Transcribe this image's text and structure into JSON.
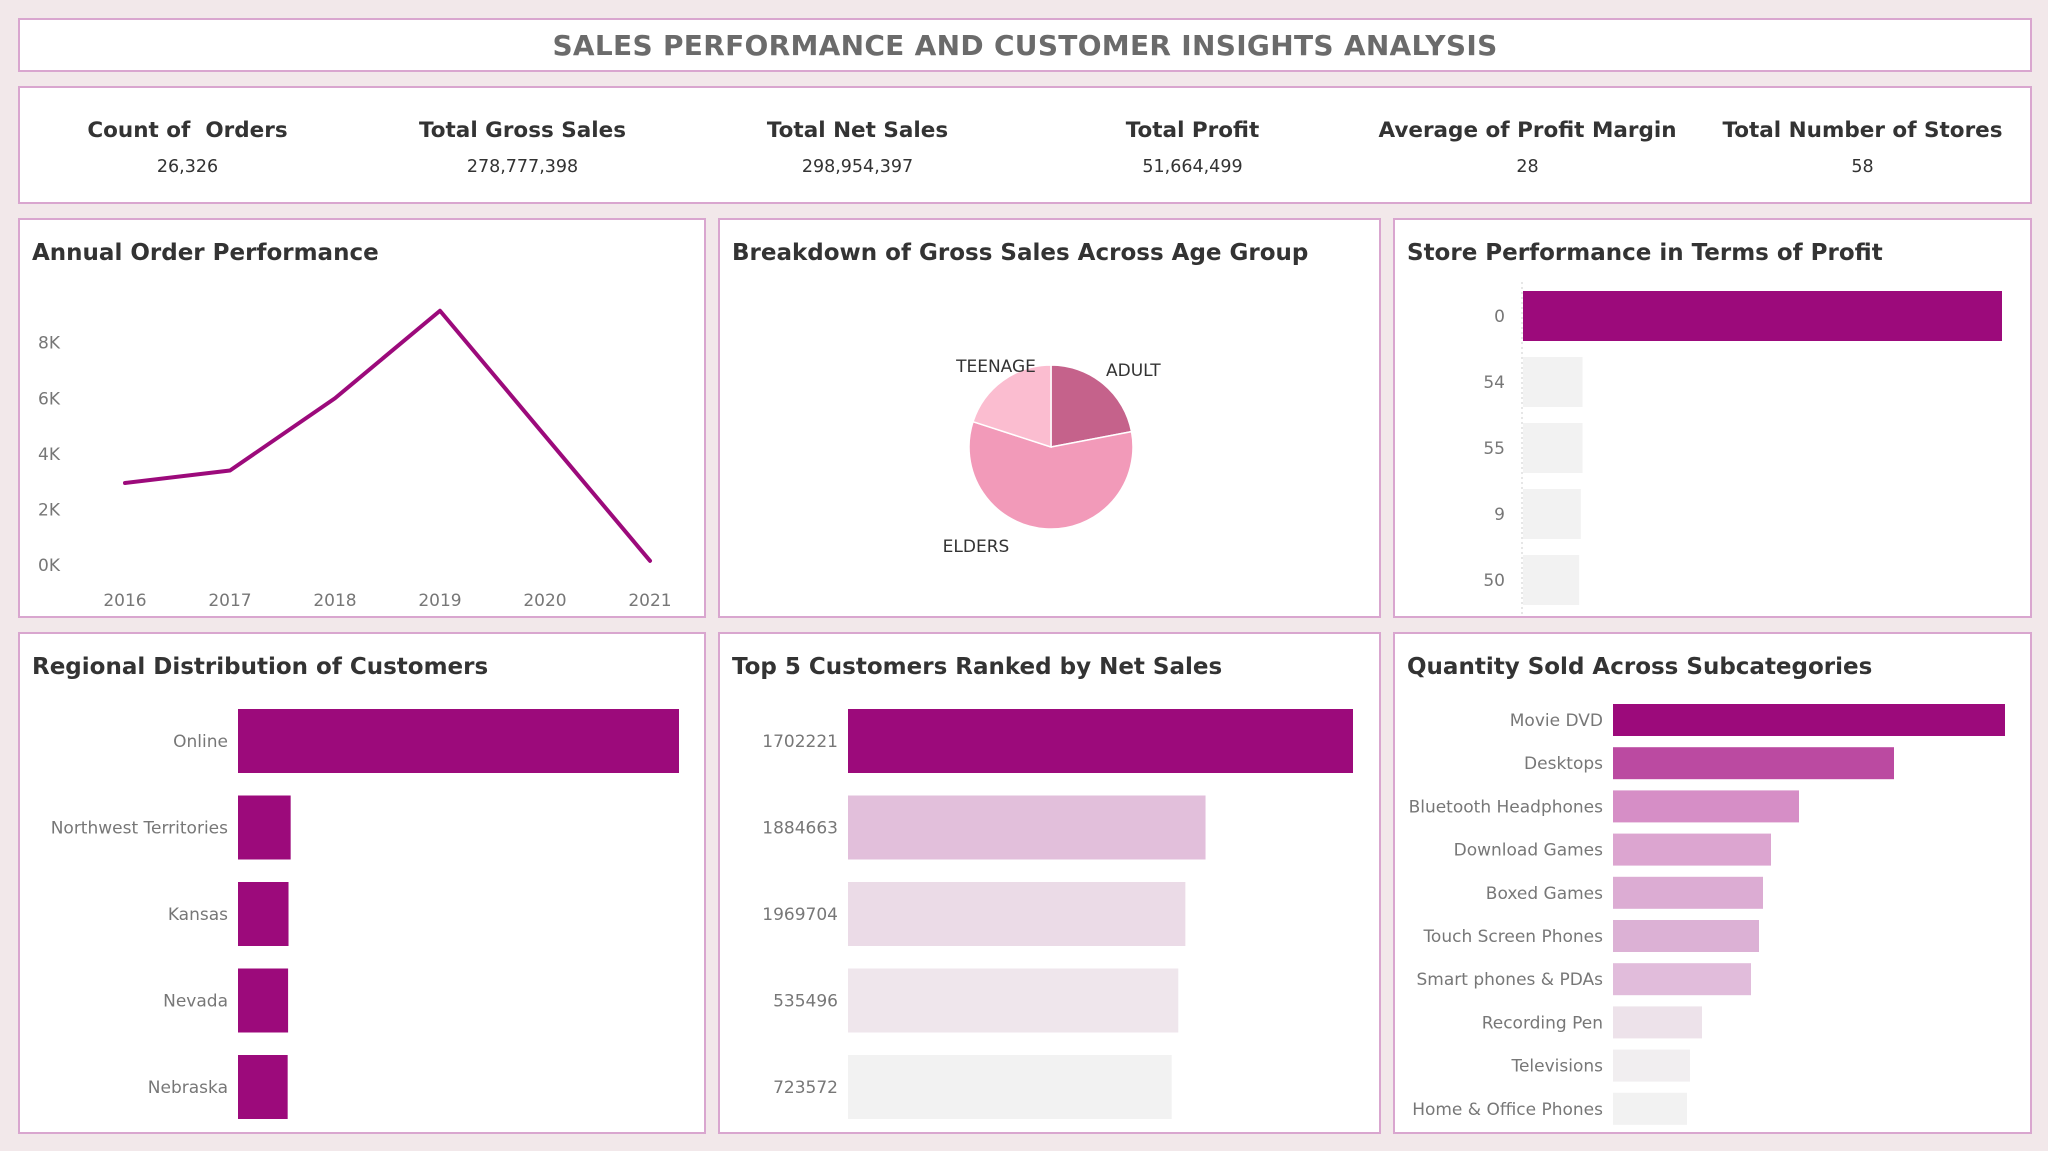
{
  "header": {
    "title": "SALES PERFORMANCE AND CUSTOMER INSIGHTS ANALYSIS"
  },
  "kpis": [
    {
      "label": "Count of  Orders",
      "value": "26,326"
    },
    {
      "label": "Total Gross Sales",
      "value": "278,777,398"
    },
    {
      "label": "Total Net Sales",
      "value": "298,954,397"
    },
    {
      "label": "Total Profit",
      "value": "51,664,499"
    },
    {
      "label": "Average of Profit Margin",
      "value": "28"
    },
    {
      "label": "Total Number of Stores",
      "value": "58"
    }
  ],
  "colors": {
    "magenta": "#9c0a7b",
    "light_bar": "#f2f2f2",
    "adult": "#c5628b",
    "elders": "#f29ab9",
    "teenage": "#fbbdd0"
  },
  "chart_data": [
    {
      "id": "annual",
      "type": "line",
      "title": "Annual Order Performance",
      "x": [
        "2016",
        "2017",
        "2018",
        "2019",
        "2020",
        "2021"
      ],
      "values": [
        2950,
        3400,
        6000,
        9150,
        4650,
        150
      ],
      "ylim": [
        0,
        9500
      ],
      "yticks": [
        0,
        2000,
        4000,
        6000,
        8000
      ],
      "ytick_labels": [
        "0K",
        "2K",
        "4K",
        "6K",
        "8K"
      ],
      "grid": false
    },
    {
      "id": "age",
      "type": "pie",
      "title": "Breakdown of Gross Sales Across Age Group",
      "slices": [
        {
          "label": "ADULT",
          "value": 22,
          "color": "#c5628b"
        },
        {
          "label": "ELDERS",
          "value": 58,
          "color": "#f29ab9"
        },
        {
          "label": "TEENAGE",
          "value": 20,
          "color": "#fbbdd0"
        }
      ]
    },
    {
      "id": "stores",
      "type": "bar",
      "orientation": "horizontal",
      "title": "Store Performance in Terms of Profit",
      "categories": [
        "0",
        "54",
        "55",
        "9",
        "50"
      ],
      "values": [
        2900000,
        360000,
        360000,
        350000,
        340000
      ],
      "colors": [
        "#9c0a7b",
        "#f2f2f2",
        "#f2f2f2",
        "#f2f2f2",
        "#f2f2f2"
      ],
      "xlim": [
        0,
        2900000
      ]
    },
    {
      "id": "regions",
      "type": "bar",
      "orientation": "horizontal",
      "title": "Regional Distribution of Customers",
      "categories": [
        "Online",
        "Northwest Territories",
        "Kansas",
        "Nevada",
        "Nebraska"
      ],
      "values": [
        10300,
        1230,
        1180,
        1170,
        1160
      ],
      "colors": [
        "#9c0a7b",
        "#9c0a7b",
        "#9c0a7b",
        "#9c0a7b",
        "#9c0a7b"
      ],
      "xlim": [
        0,
        10300
      ]
    },
    {
      "id": "customers",
      "type": "bar",
      "orientation": "horizontal",
      "title": "Top 5 Customers Ranked by Net Sales",
      "categories": [
        "1702221",
        "1884663",
        "1969704",
        "535496",
        "723572"
      ],
      "values": [
        1000,
        708,
        668,
        654,
        641
      ],
      "colors": [
        "#9c0a7b",
        "#e2bfdb",
        "#ebdbe7",
        "#efe6ec",
        "#f2f2f2"
      ],
      "xlim": [
        0,
        1000
      ]
    },
    {
      "id": "subcats",
      "type": "bar",
      "orientation": "horizontal",
      "title": "Quantity Sold Across Subcategories",
      "categories": [
        "Movie DVD",
        "Desktops",
        "Bluetooth Headphones",
        "Download Games",
        "Boxed Games",
        "Touch Screen Phones",
        "Smart phones & PDAs",
        "Recording Pen",
        "Televisions",
        "Home & Office Phones"
      ],
      "values": [
        3920,
        2810,
        1860,
        1580,
        1500,
        1460,
        1380,
        890,
        770,
        740
      ],
      "colors": [
        "#9c0a7b",
        "#bb4aa1",
        "#d68ec6",
        "#dca5d0",
        "#dcacd3",
        "#dcb1d5",
        "#e1bcdb",
        "#ede2ea",
        "#f1eef0",
        "#f2f2f2"
      ],
      "xlim": [
        0,
        3920
      ]
    }
  ]
}
